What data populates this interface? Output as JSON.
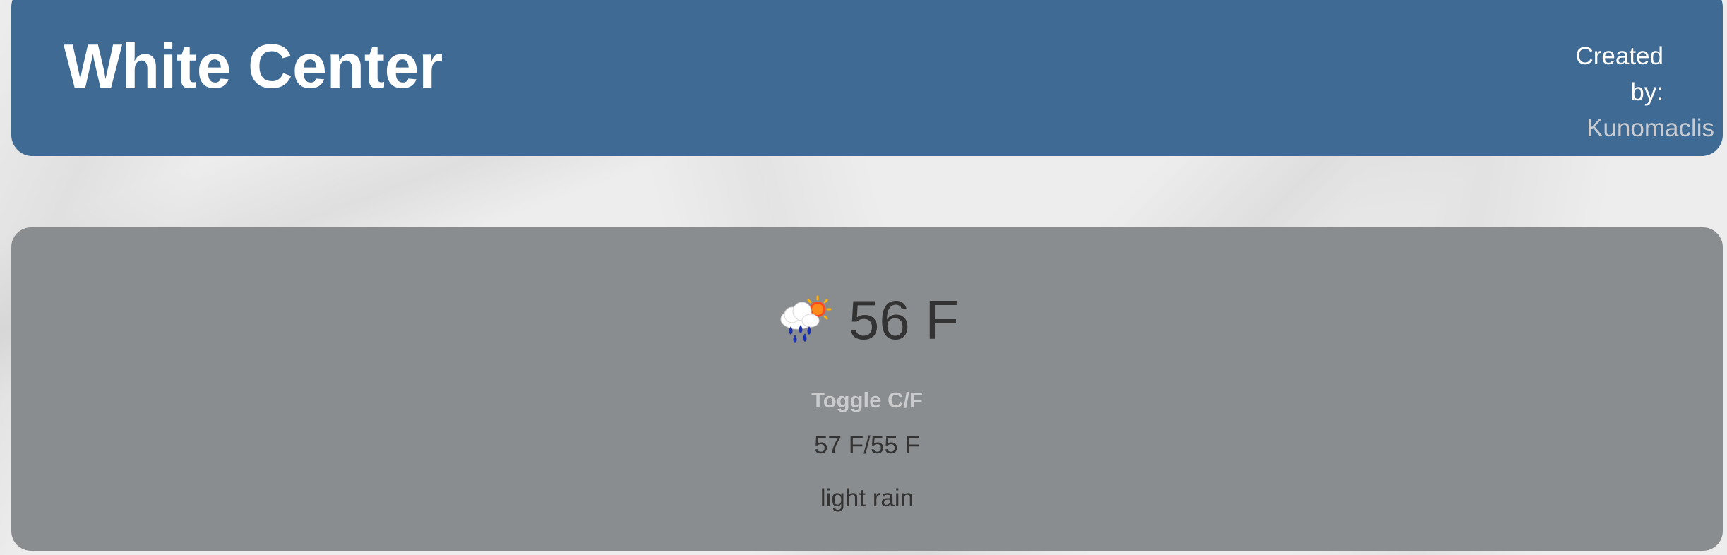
{
  "header": {
    "city": "White Center",
    "created_by_label_1": "Created",
    "created_by_label_2": "by:",
    "author": "Kunomaclis"
  },
  "weather": {
    "icon": "rain-cloud-sun-icon",
    "temperature": "56 F",
    "toggle_label": "Toggle C/F",
    "high_low": "57 F/55 F",
    "description": "light rain"
  },
  "colors": {
    "header_bg": "#3e6a94",
    "card_bg": "#8a8d90",
    "page_bg": "#ededed",
    "text_dark": "#333333",
    "text_light": "#c9cbcd"
  }
}
